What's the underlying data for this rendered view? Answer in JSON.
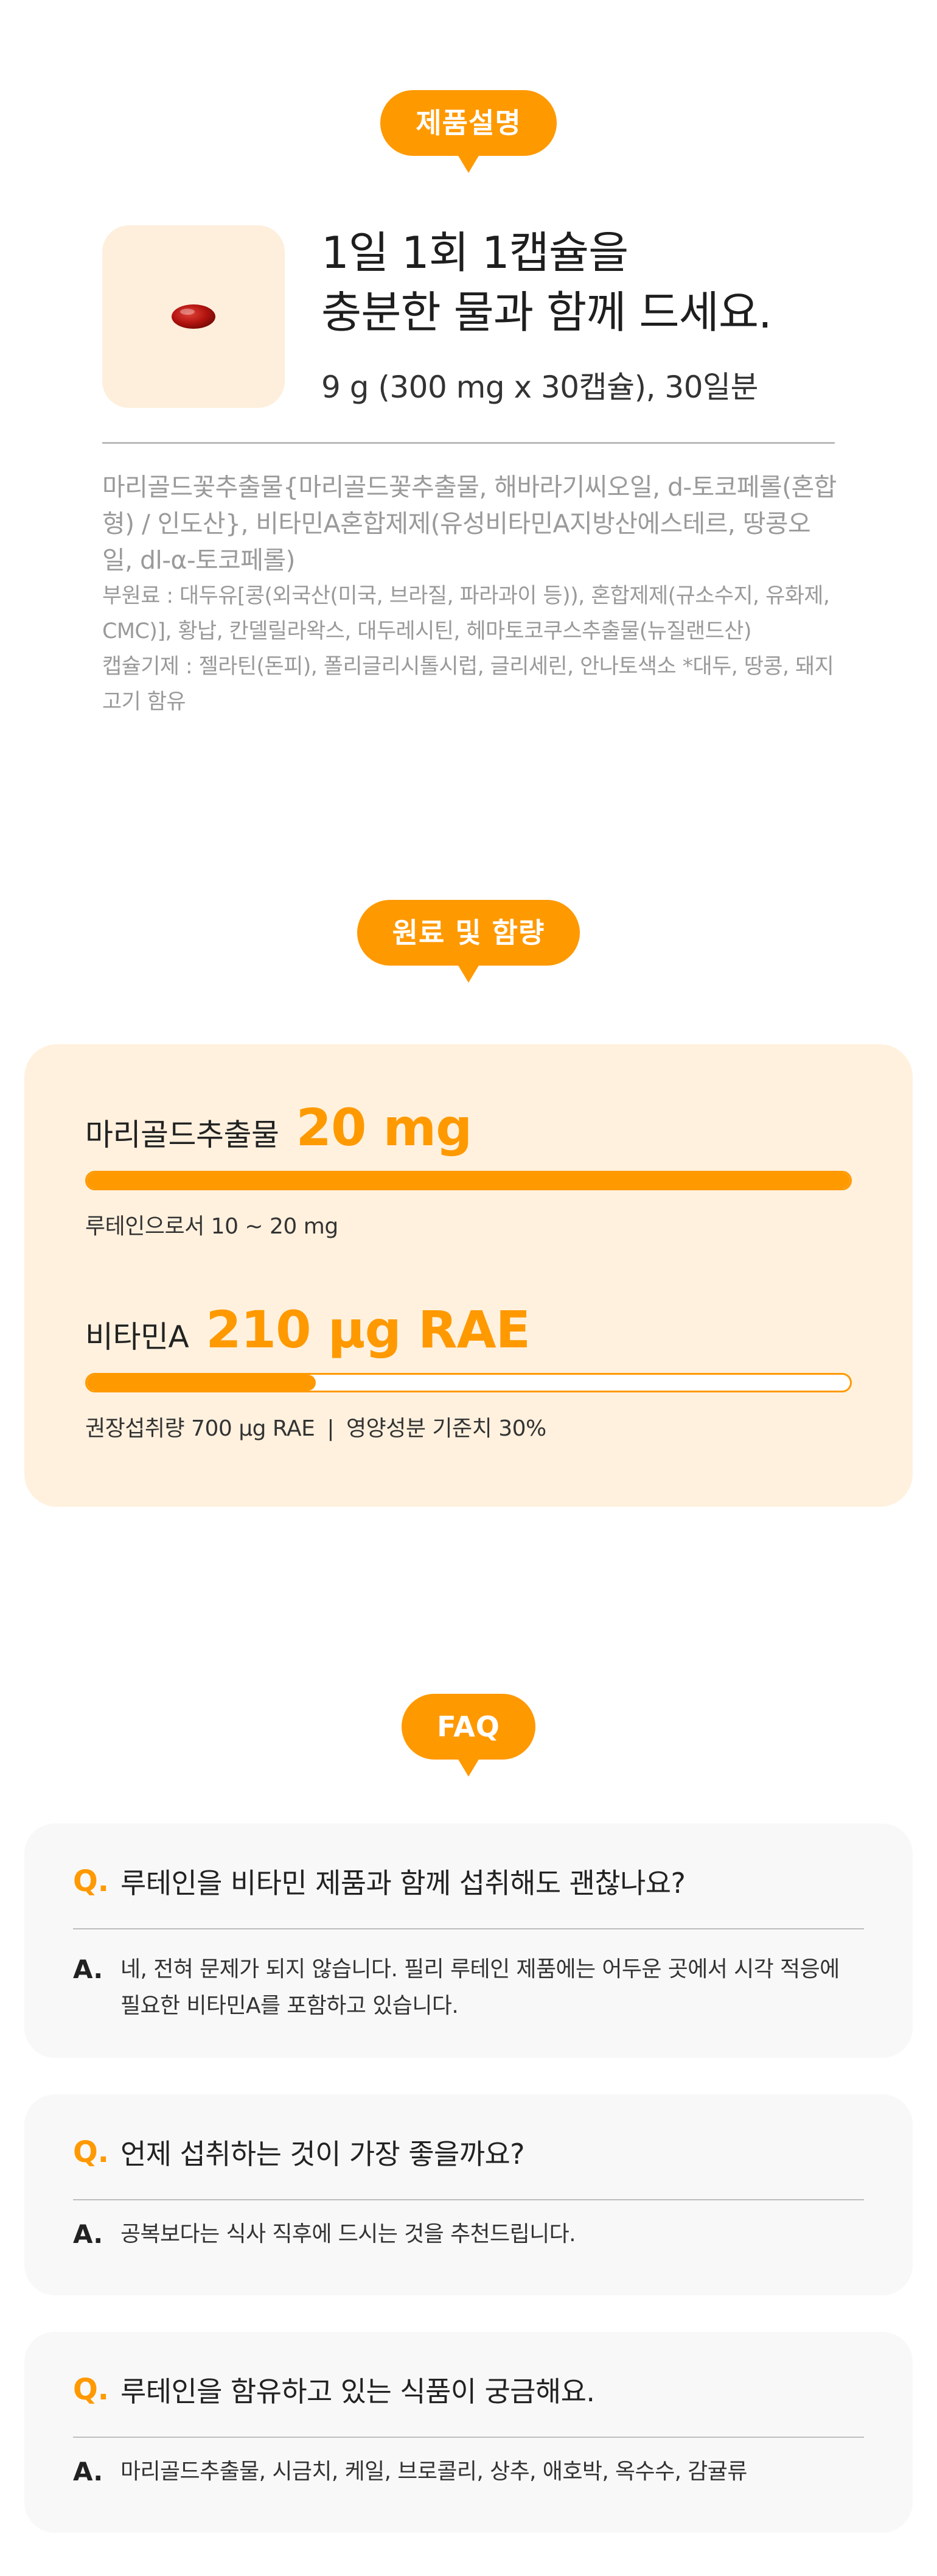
{
  "description": {
    "badge": "제품설명",
    "dose_line1": "1일 1회 1캡슐을",
    "dose_line2": "충분한 물과 함께 드세요.",
    "dose_sub": "9 g (300 mg x 30캡슐), 30일분",
    "ingredients_main": "마리골드꽃추출물{마리골드꽃추출물, 해바라기씨오일, d-토코페롤(혼합형) / 인도산}, 비타민A혼합제제(유성비타민A지방산에스테르, 땅콩오일, dl-α-토코페롤)",
    "ingredients_sub": "부원료 : 대두유[콩(외국산(미국, 브라질, 파라과이 등)), 혼합제제(규소수지, 유화제, CMC)], 황납, 칸델릴라왁스, 대두레시틴, 헤마토코쿠스추출물(뉴질랜드산)",
    "ingredients_capsule": "캡슐기제 : 젤라틴(돈피), 폴리글리시톨시럽, 글리세린, 안나토색소 *대두, 땅콩, 돼지고기 함유",
    "capsule_icon": "red-softgel-capsule"
  },
  "content": {
    "badge": "원료 및 함량",
    "nutrients": [
      {
        "name": "마리골드추출물",
        "amount": "20 mg",
        "fill_percent": 100,
        "note": "루테인으로서 10 ~ 20 mg"
      },
      {
        "name": "비타민A",
        "amount": "210 μg RAE",
        "fill_percent": 30,
        "note_left": "권장섭취량 700 μg RAE",
        "note_sep": "|",
        "note_right": "영양성분 기준치 30%"
      }
    ]
  },
  "faq": {
    "badge": "FAQ",
    "q_mark": "Q.",
    "a_mark": "A.",
    "items": [
      {
        "question": "루테인을 비타민 제품과 함께 섭취해도 괜찮나요?",
        "answer": "네, 전혀 문제가 되지 않습니다. 필리 루테인 제품에는 어두운 곳에서 시각 적응에 필요한 비타민A를 포함하고 있습니다."
      },
      {
        "question": "언제 섭취하는 것이 가장 좋을까요?",
        "answer": "공복보다는 식사 직후에 드시는 것을 추천드립니다."
      },
      {
        "question": "루테인을 함유하고 있는 식품이 궁금해요.",
        "answer": "마리골드추출물, 시금치, 케일, 브로콜리, 상추, 애호박, 옥수수, 감귤류"
      }
    ]
  },
  "colors": {
    "accent": "#ff9900",
    "card_bg": "#fff1de",
    "capsule_box_bg": "#fdefdc",
    "faq_bg": "#f8f8f8",
    "capsule_red": "#b3140f"
  }
}
